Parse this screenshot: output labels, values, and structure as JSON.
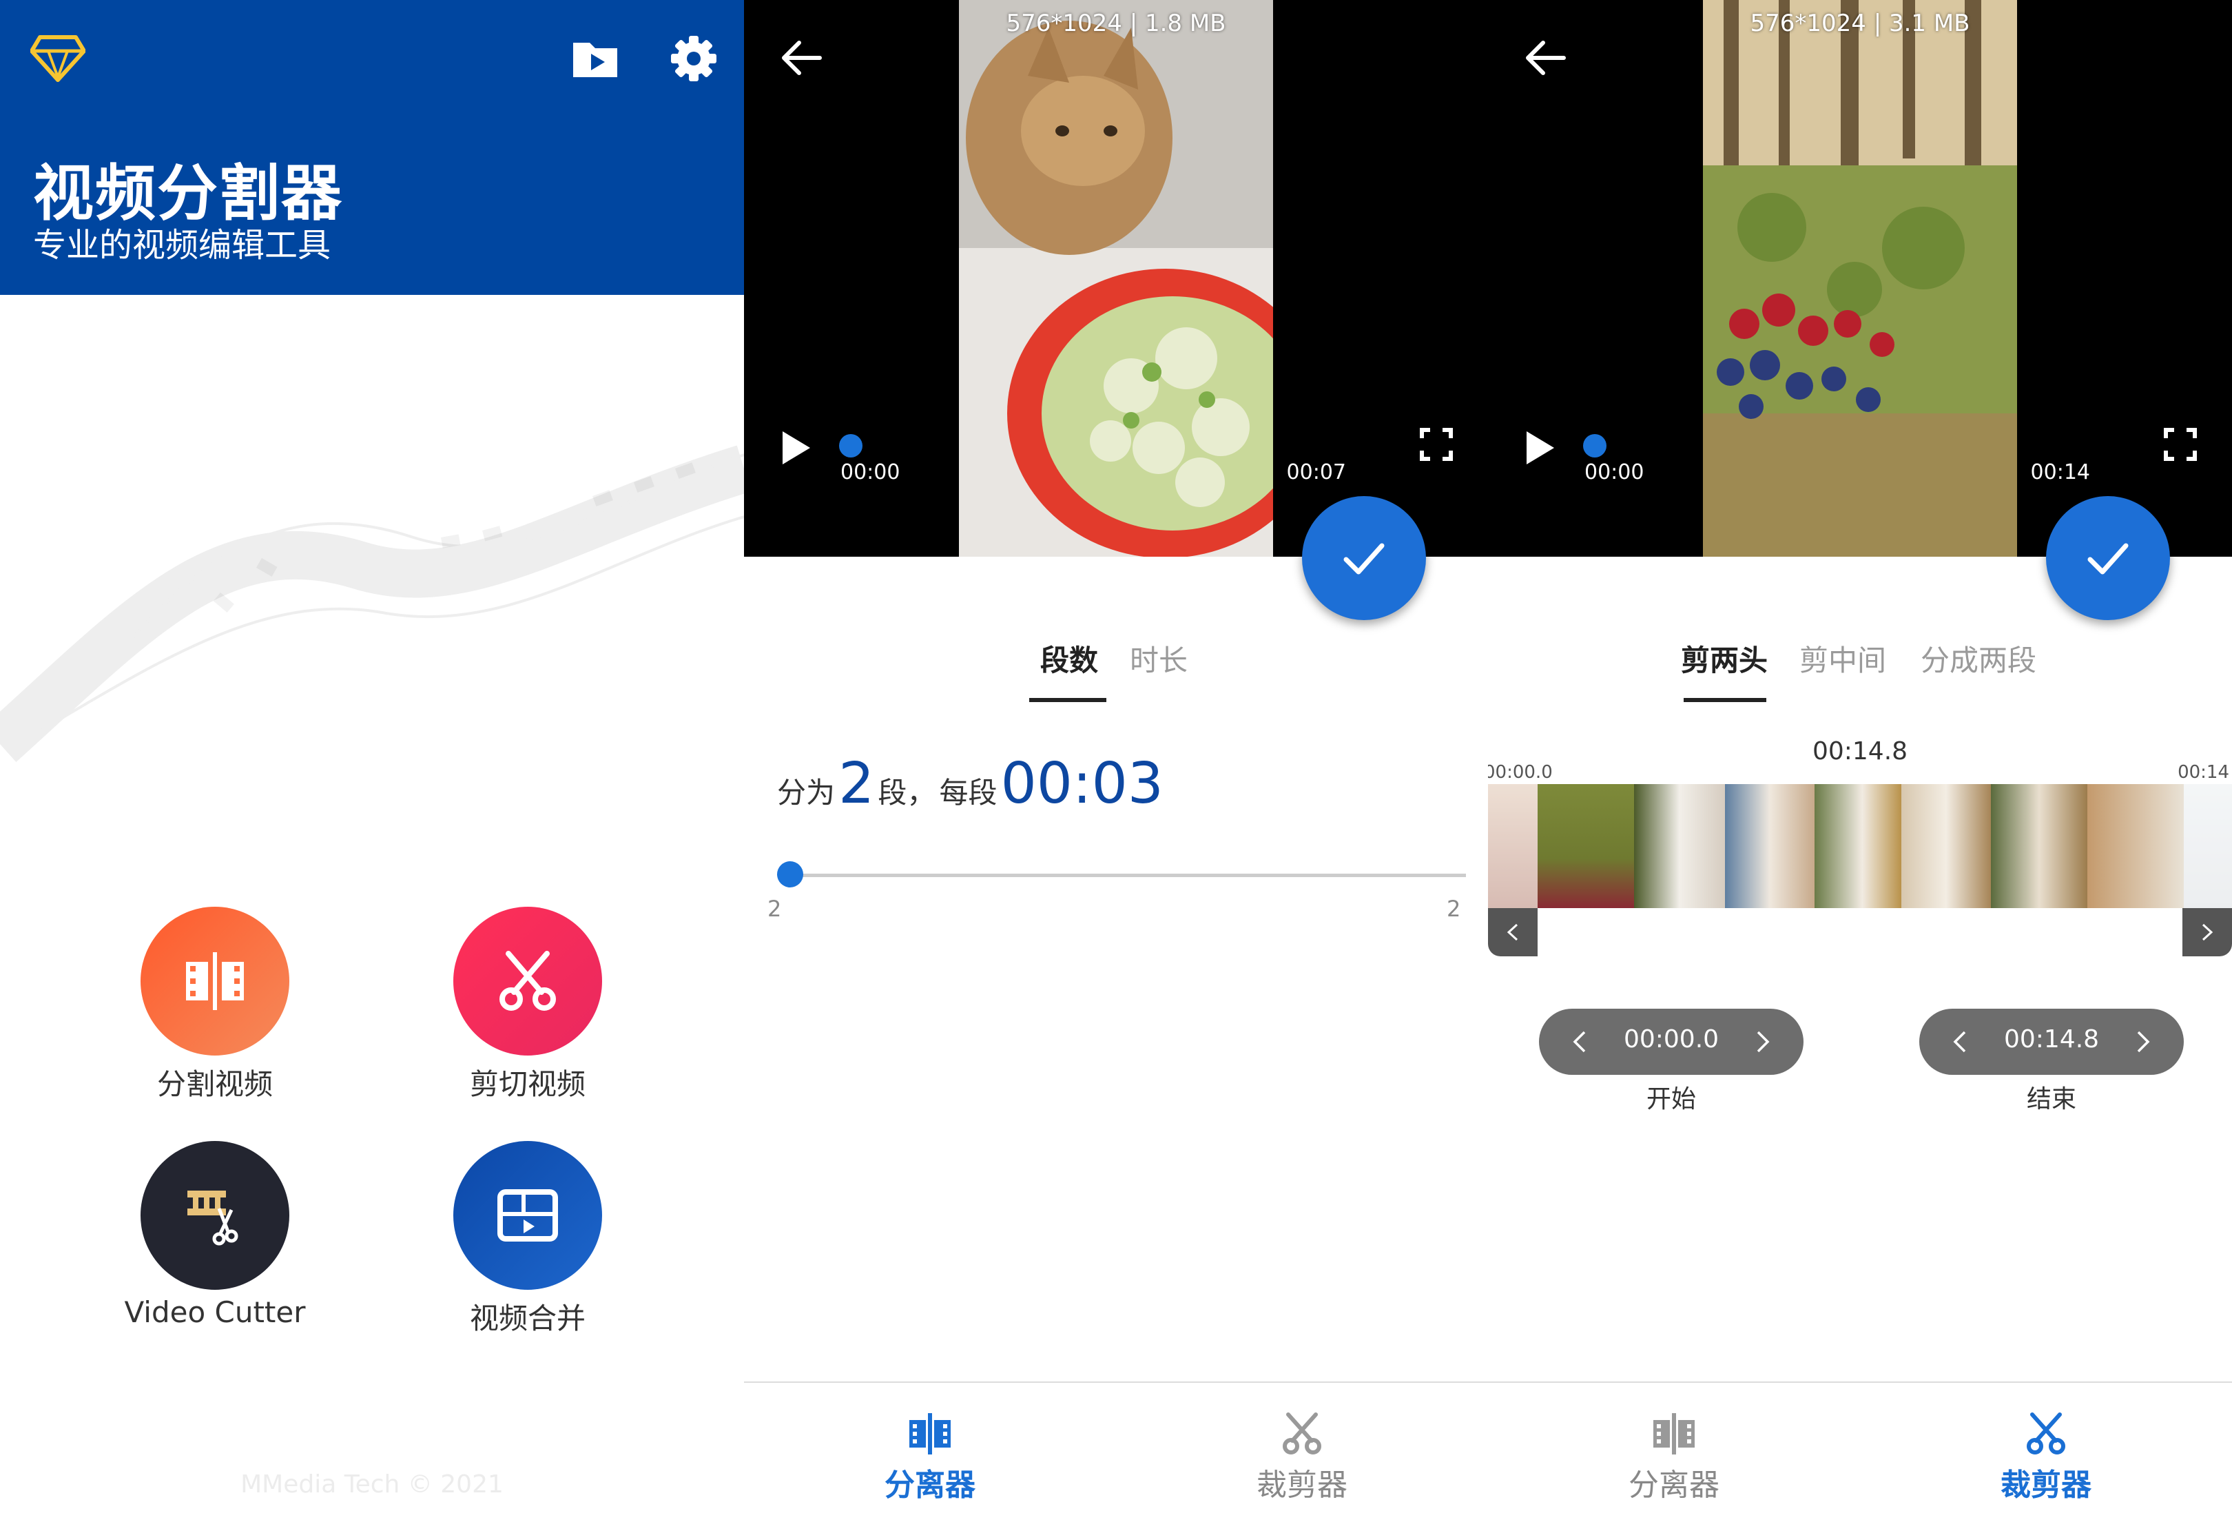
{
  "colors": {
    "brand_blue": "#0046a0",
    "accent_blue": "#1a73d9",
    "inactive_gray": "#9a9a9a"
  },
  "home": {
    "title": "视频分割器",
    "subtitle": "专业的视频编辑工具",
    "icons": {
      "logo": "diamond-icon",
      "folder": "video-folder-icon",
      "settings": "gear-icon"
    },
    "buttons": [
      {
        "label": "分割视频",
        "icon": "split-video-icon"
      },
      {
        "label": "剪切视频",
        "icon": "scissors-icon"
      },
      {
        "label": "Video Cutter",
        "icon": "film-scissors-icon"
      },
      {
        "label": "视频合并",
        "icon": "merge-video-icon"
      }
    ],
    "copyright": "MMedia Tech © 2021"
  },
  "splitter": {
    "video_info": "576*1024 | 1.8 MB",
    "time_current": "00:00",
    "time_total": "00:07",
    "tabs": [
      "段数",
      "时长"
    ],
    "active_tab": 0,
    "segment_text": {
      "prefix": "分为",
      "count": "2",
      "unit": "段，",
      "each": "每段",
      "duration": "00:03"
    },
    "slider": {
      "min": "2",
      "max": "2",
      "value_fraction": 0
    }
  },
  "cutter": {
    "video_info": "576*1024 | 3.1 MB",
    "time_current": "00:00",
    "time_total": "00:14",
    "tabs": [
      "剪两头",
      "剪中间",
      "分成两段"
    ],
    "active_tab": 0,
    "duration": "00:14.8",
    "timeline_start": "00:00.0",
    "timeline_end": "00:14",
    "start": {
      "value": "00:00.0",
      "label": "开始"
    },
    "end": {
      "value": "00:14.8",
      "label": "结束"
    }
  },
  "bottom_nav": [
    {
      "label": "分离器",
      "icon": "splitter-icon",
      "active": true
    },
    {
      "label": "裁剪器",
      "icon": "scissors-icon",
      "active": false
    },
    {
      "label": "分离器",
      "icon": "splitter-icon",
      "active": false
    },
    {
      "label": "裁剪器",
      "icon": "scissors-icon",
      "active": true
    }
  ]
}
